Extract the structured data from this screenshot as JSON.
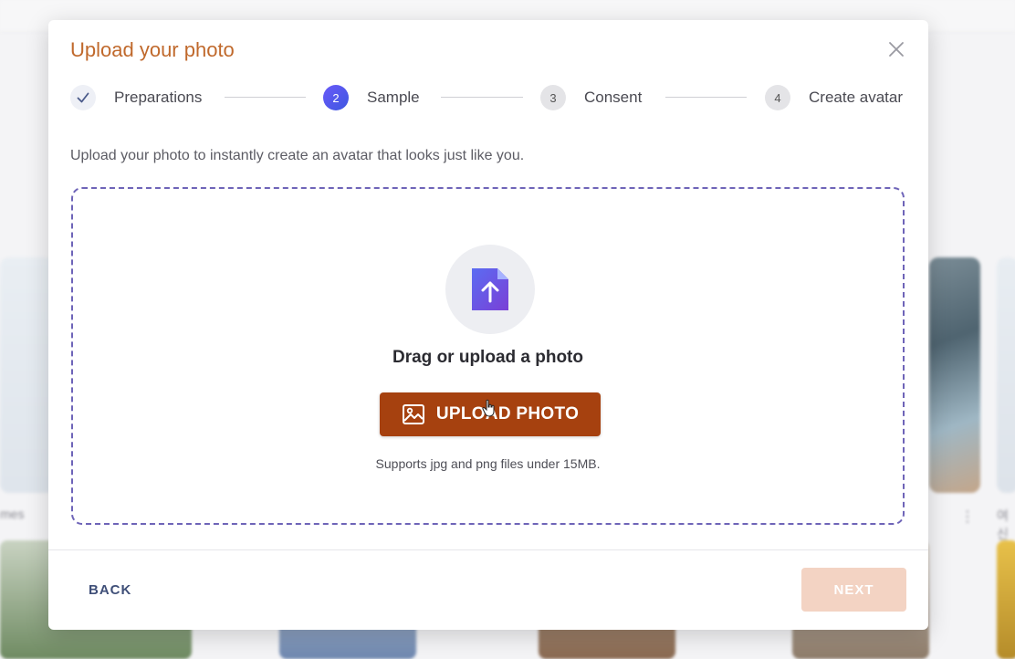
{
  "background": {
    "left_label": "mes",
    "right_label": "여신"
  },
  "dialog": {
    "title": "Upload your photo",
    "steps": [
      {
        "number": "",
        "label": "Preparations",
        "state": "done"
      },
      {
        "number": "2",
        "label": "Sample",
        "state": "active"
      },
      {
        "number": "3",
        "label": "Consent",
        "state": "pending"
      },
      {
        "number": "4",
        "label": "Create avatar",
        "state": "pending"
      }
    ],
    "intro": "Upload your photo to instantly create an avatar that looks just like you.",
    "dropzone": {
      "title": "Drag or upload a photo",
      "button_label": "UPLOAD PHOTO",
      "hint": "Supports jpg and png files under 15MB."
    },
    "footer": {
      "back_label": "BACK",
      "next_label": "NEXT"
    }
  },
  "colors": {
    "title": "#c0692c",
    "upload_button": "#a6410f",
    "next_disabled": "#f3d3c3",
    "step_active": "#4f57ee",
    "dropzone_border": "#6e64b8"
  },
  "icons": {
    "close": "close-icon",
    "step_done": "check-icon",
    "upload_file": "file-upload-icon",
    "upload_button": "image-icon"
  }
}
